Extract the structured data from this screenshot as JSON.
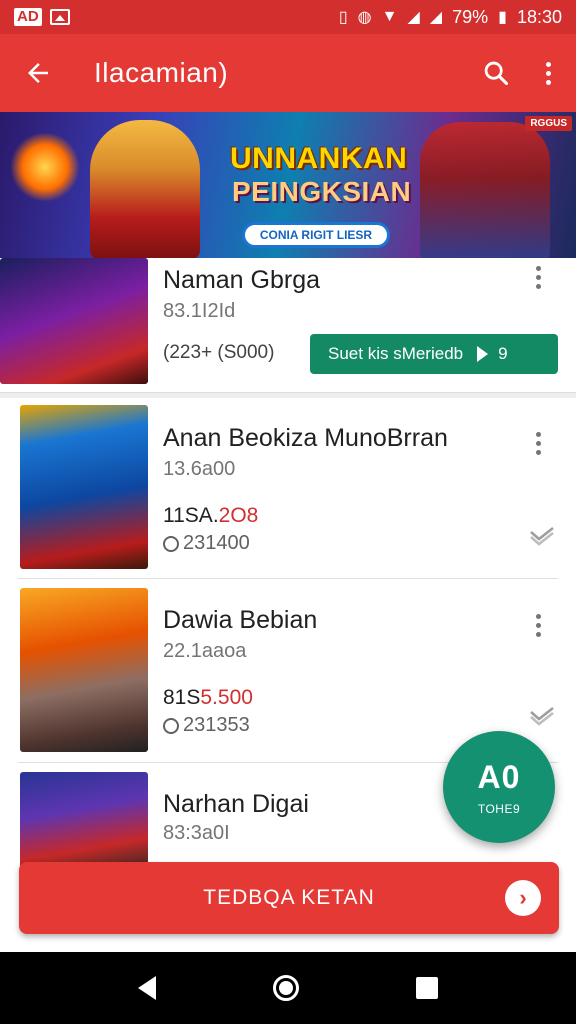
{
  "status_bar": {
    "left_badge": "AD",
    "battery": "79%",
    "time": "18:30"
  },
  "app_bar": {
    "title": "Ilacamian)",
    "back_icon": "arrow-left-icon",
    "search_icon": "search-icon",
    "more_icon": "more-vert-icon"
  },
  "banner": {
    "title_line1": "UNNANKAN",
    "title_line2": "PEINGKSIAN",
    "pill_text": "CONIA RIGIT LIESR",
    "tag": "RGGUS"
  },
  "items": [
    {
      "title": "Naman Gbrga",
      "subtitle": "83.1I2Id",
      "price": "(223+  (S000)",
      "action_label": "Suet kis sMeriedb",
      "action_suffix": "9",
      "thumb_colors": [
        "#1a1f5e",
        "#7b1fa2",
        "#c62828"
      ]
    },
    {
      "title": "Anan Beokiza MunoBrran",
      "subtitle": "13.6a00",
      "price_main": "11SA.",
      "price_red": "2O8",
      "views": "231400",
      "thumb_colors": [
        "#0d47a1",
        "#1976d2",
        "#b71c1c"
      ]
    },
    {
      "title": "Dawia Bebian",
      "subtitle": "22.1aaoa",
      "price_main": "81S",
      "price_red": "5.500",
      "views": "231353",
      "thumb_colors": [
        "#e65100",
        "#f9a825",
        "#4e342e"
      ]
    },
    {
      "title": "Narhan Digai",
      "subtitle": "83:3a0I",
      "thumb_colors": [
        "#283593",
        "#5e35b1",
        "#c62828"
      ]
    }
  ],
  "fab": {
    "main": "A0",
    "sub": "TOHE9"
  },
  "bottom_action": {
    "label": "TEDBQA KETAN",
    "arrow_icon": "chevron-right-icon"
  },
  "nav": {
    "back_icon": "nav-back-icon",
    "home_icon": "nav-home-icon",
    "recent_icon": "nav-recent-icon"
  }
}
